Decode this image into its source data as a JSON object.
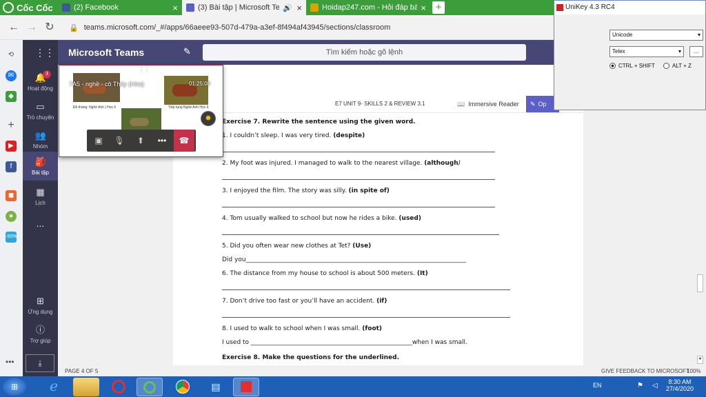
{
  "browser": {
    "brand": "Cốc Cốc",
    "tabs": [
      {
        "title": "(2) Facebook",
        "favicon_color": "#3b5998"
      },
      {
        "title": "(3) Bài tập | Microsoft Team",
        "favicon_color": "#5b5fc7"
      },
      {
        "title": "Hoidap247.com - Hỏi đáp bài",
        "favicon_color": "#d9a400"
      }
    ],
    "new_tab": "+",
    "url": "teams.microsoft.com/_#/apps/66aeee93-507d-479a-a3ef-8f494af43945/sections/classroom"
  },
  "teams": {
    "app_title": "Microsoft Teams",
    "search_placeholder": "Tìm kiếm hoặc gõ lệnh",
    "rail": [
      {
        "label": "Hoạt động",
        "icon": "bell-icon",
        "badge": "3"
      },
      {
        "label": "Trò chuyện",
        "icon": "chat-icon"
      },
      {
        "label": "Nhóm",
        "icon": "teams-icon"
      },
      {
        "label": "Bài tập",
        "icon": "assignments-icon"
      },
      {
        "label": "Lịch",
        "icon": "calendar-icon"
      },
      {
        "label": "...",
        "icon": "more-icon"
      },
      {
        "label": "Ứng dụng",
        "icon": "apps-icon"
      },
      {
        "label": "Trợ giúp",
        "icon": "help-icon"
      }
    ]
  },
  "call": {
    "title": "7A5 - nghề - cô Thủy (Hóa)",
    "timer": "01:25:08",
    "caption_left": "Đề tháng: Nghề Anh | Học 6",
    "caption_right": "Tiếp tụng Nghề Anh Học 6"
  },
  "document": {
    "title": "E7 UNIT 9- SKILLS 2 & REVIEW 3.1",
    "immersive_reader": "Immersive Reader",
    "open_button": "Op",
    "lines": [
      {
        "html": "<b>Exercise 7. Rewrite the sentence using the given word.</b>"
      },
      {
        "html": "1. I couldn’t sleep. I was very tired. <b>(despite)</b>"
      },
      {
        "blank": 396
      },
      {
        "html": "2. My foot was injured. I managed to walk to the nearest village. <b>(although</b><i>)</i>"
      },
      {
        "blank": 396
      },
      {
        "html": "3. I enjoyed the film. The story was silly.  <b>(in spite of)</b>"
      },
      {
        "blank": 396
      },
      {
        "html": "4. Tom usually walked to school but now he rides a bike.  <b>(used)</b>"
      },
      {
        "blank": 402
      },
      {
        "html": "5. Did you often wear new clothes at Tet?  <b>(Use)</b>"
      },
      {
        "html": "Did you_______________________________________________________________________"
      },
      {
        "html": "6. The distance from my house to school is about 500 meters. <b>(It)</b>"
      },
      {
        "blank": 418
      },
      {
        "html": "7. Don’t drive too fast or you’ll have an accident. <b>(if)</b>"
      },
      {
        "blank": 418
      },
      {
        "html": "8. I used to walk to school when I was small. <b>(foot)</b>"
      },
      {
        "html": "I used to ____________________________________________________when I was small."
      },
      {
        "html": "<b>Exercise 8.  Make the questions for the underlined.</b>"
      }
    ],
    "page_indicator": "PAGE 4 OF 5",
    "feedback": "GIVE FEEDBACK TO MICROSOFT",
    "zoom": "100%"
  },
  "unikey": {
    "title": "UniKey 4.3 RC4",
    "charset": "Unicode",
    "input_method": "Telex",
    "more_button": "...",
    "hotkey_1": "CTRL + SHIFT",
    "hotkey_2": "ALT + Z"
  },
  "taskbar": {
    "lang": "EN",
    "time": "8:30 AM",
    "date": "27/4/2020"
  }
}
